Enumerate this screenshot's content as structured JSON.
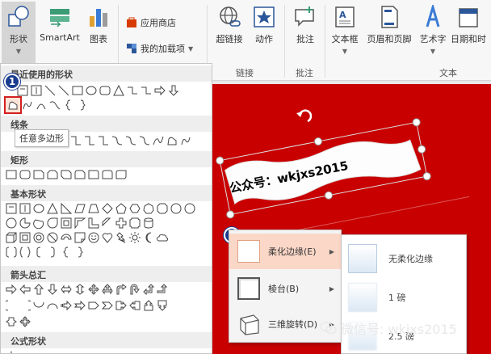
{
  "ribbon": {
    "shapes_label": "形状",
    "smartart_label": "SmartArt",
    "chart_label": "图表",
    "app_store_label": "应用商店",
    "my_addins_label": "我的加载项",
    "hyperlink_label": "超链接",
    "action_label": "动作",
    "links_group": "链接",
    "comment_label": "批注",
    "comment_group": "批注",
    "textbox_label": "文本框",
    "header_footer_label": "页眉和页脚",
    "wordart_label": "艺术字",
    "datetime_label": "日期和时",
    "text_group": "文本"
  },
  "shapes_panel": {
    "recent": "最近使用的形状",
    "lines": "线条",
    "rectangles": "矩形",
    "basic": "基本形状",
    "arrows": "箭头总汇",
    "equation": "公式形状",
    "tooltip": "任意多边形"
  },
  "slide": {
    "banner_text": "公众号：wkjxs2015"
  },
  "context_menu": {
    "items": [
      {
        "label": "柔化边缘(E)"
      },
      {
        "label": "棱台(B)"
      },
      {
        "label": "三维旋转(D)"
      }
    ]
  },
  "submenu": {
    "items": [
      {
        "label": "无柔化边缘"
      },
      {
        "label": "1 磅"
      },
      {
        "label": "2.5 磅"
      }
    ]
  },
  "badges": {
    "one": "1",
    "two": "2"
  },
  "watermark": "微信号: wkjxs2015",
  "colors": {
    "slide_bg": "#c80000",
    "highlight": "#fbd7c7",
    "badge": "#1a3c8f",
    "accent_box": "#d32020"
  }
}
